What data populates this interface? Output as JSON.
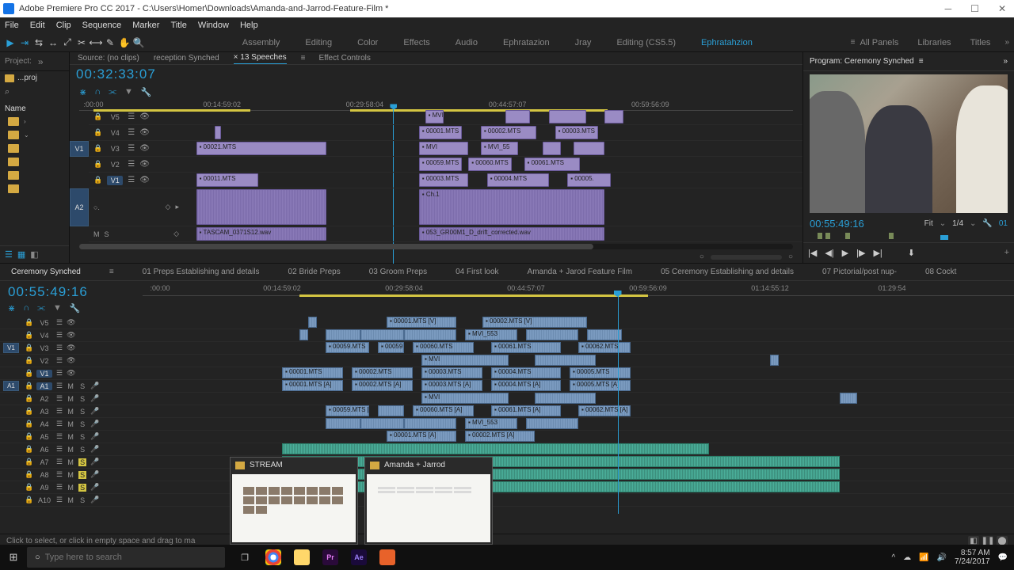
{
  "title": "Adobe Premiere Pro CC 2017 - C:\\Users\\Homer\\Downloads\\Amanda-and-Jarrod-Feature-Film *",
  "menu": [
    "File",
    "Edit",
    "Clip",
    "Sequence",
    "Marker",
    "Title",
    "Window",
    "Help"
  ],
  "workspaces": [
    "Assembly",
    "Editing",
    "Color",
    "Effects",
    "Audio",
    "Ephratazion",
    "Jray",
    "Editing (CS5.5)",
    "Ephratahzion"
  ],
  "ws_active": "Ephratahzion",
  "ws_right": [
    "All Panels",
    "Libraries",
    "Titles"
  ],
  "project": {
    "tab": "Project:",
    "bin": "...proj",
    "name_head": "Name"
  },
  "source": {
    "tabs": [
      "Source: (no clips)",
      "reception Synched",
      "× 13 Speeches",
      "Effect Controls"
    ],
    "active_idx": 2,
    "timecode": "00:32:33:07",
    "ruler_ticks": [
      {
        "t": ":00:00",
        "pct": 2
      },
      {
        "t": "00:14:59:02",
        "pct": 20
      },
      {
        "t": "00:29:58:04",
        "pct": 40
      },
      {
        "t": "00:44:57:07",
        "pct": 60
      },
      {
        "t": "00:59:56:09",
        "pct": 80
      }
    ],
    "playhead_pct": 44,
    "yellow": [
      {
        "l": 2,
        "w": 22
      },
      {
        "l": 38,
        "w": 36
      }
    ],
    "tracks": [
      {
        "lbl": "V5"
      },
      {
        "lbl": "V4"
      },
      {
        "lbl": "V3"
      },
      {
        "lbl": "V2"
      },
      {
        "lbl": "V1",
        "box": true
      }
    ],
    "target_v": "V1",
    "target_a": "A2",
    "clips_v5": [
      {
        "l": 39,
        "w": 3,
        "n": "MVI"
      },
      {
        "l": 52,
        "w": 4,
        "n": ""
      },
      {
        "l": 59,
        "w": 6,
        "n": ""
      },
      {
        "l": 68,
        "w": 3,
        "n": ""
      }
    ],
    "clips_v4": [
      {
        "l": 5,
        "w": 1,
        "n": ""
      },
      {
        "l": 38,
        "w": 7,
        "n": "00001.MTS"
      },
      {
        "l": 48,
        "w": 9,
        "n": "00002.MTS"
      },
      {
        "l": 60,
        "w": 7,
        "n": "00003.MTS"
      }
    ],
    "clips_v3": [
      {
        "l": 2,
        "w": 21,
        "n": "00021.MTS"
      },
      {
        "l": 38,
        "w": 8,
        "n": "MVI"
      },
      {
        "l": 48,
        "w": 6,
        "n": "MVI_55"
      },
      {
        "l": 58,
        "w": 3,
        "n": ""
      },
      {
        "l": 63,
        "w": 5,
        "n": ""
      }
    ],
    "clips_v2": [
      {
        "l": 38,
        "w": 7,
        "n": "00059.MTS"
      },
      {
        "l": 46,
        "w": 7,
        "n": "00060.MTS"
      },
      {
        "l": 55,
        "w": 9,
        "n": "00061.MTS"
      }
    ],
    "clips_v1": [
      {
        "l": 2,
        "w": 10,
        "n": "00011.MTS"
      },
      {
        "l": 38,
        "w": 8,
        "n": "00003.MTS"
      },
      {
        "l": 49,
        "w": 10,
        "n": "00004.MTS"
      },
      {
        "l": 62,
        "w": 7,
        "n": "00005."
      }
    ],
    "clips_a1": [
      {
        "l": 2,
        "w": 21,
        "n": "",
        "wave": true
      },
      {
        "l": 38,
        "w": 30,
        "n": "Ch.1",
        "wave": true
      }
    ],
    "clips_a2": [
      {
        "l": 2,
        "w": 21,
        "n": "TASCAM_0371S12.wav",
        "wave": true
      },
      {
        "l": 38,
        "w": 30,
        "n": "053_GR00M1_D_drift_corrected.wav",
        "wave": true
      }
    ]
  },
  "program": {
    "tab": "Program: Ceremony Synched",
    "timecode": "00:55:49:16",
    "fit": "Fit",
    "zoom": "1/4",
    "frame": "01"
  },
  "timeline": {
    "seq_tabs": [
      "Ceremony Synched",
      "01 Preps Establishing and details",
      "02 Bride Preps",
      "03 Groom Preps",
      "04 First look",
      "Amanda + Jarod Feature Film",
      "05 Ceremony Establishing and details",
      "07 Pictorial/post nup-",
      "08 Cockt"
    ],
    "active_idx": 0,
    "timecode": "00:55:49:16",
    "ruler_ticks": [
      {
        "t": ":00:00",
        "pct": 2
      },
      {
        "t": "00:14:59:02",
        "pct": 16
      },
      {
        "t": "00:29:58:04",
        "pct": 30
      },
      {
        "t": "00:44:57:07",
        "pct": 44
      },
      {
        "t": "00:59:56:09",
        "pct": 58
      },
      {
        "t": "01:14:55:12",
        "pct": 72
      },
      {
        "t": "01:29:54",
        "pct": 86
      }
    ],
    "playhead_pct": 54.5,
    "yellow": [
      {
        "l": 18,
        "w": 40
      }
    ],
    "vtracks": [
      {
        "lbl": "V5"
      },
      {
        "lbl": "V4"
      },
      {
        "lbl": "V3",
        "tgt": "V1"
      },
      {
        "lbl": "V2"
      },
      {
        "lbl": "V1",
        "box": true
      }
    ],
    "atracks": [
      {
        "lbl": "A1",
        "box": true,
        "tgt": "A1"
      },
      {
        "lbl": "A2"
      },
      {
        "lbl": "A3"
      },
      {
        "lbl": "A4"
      },
      {
        "lbl": "A5"
      },
      {
        "lbl": "A6"
      },
      {
        "lbl": "A7",
        "solo": true
      },
      {
        "lbl": "A8",
        "solo": true
      },
      {
        "lbl": "A9",
        "solo": true
      },
      {
        "lbl": "A10"
      }
    ],
    "vclips": {
      "V5": [
        {
          "l": 19,
          "w": 1
        },
        {
          "l": 28,
          "w": 8,
          "n": "00001.MTS [V]"
        },
        {
          "l": 39,
          "w": 12,
          "n": "00002.MTS [V]"
        }
      ],
      "V4": [
        {
          "l": 18,
          "w": 1
        },
        {
          "l": 21,
          "w": 4
        },
        {
          "l": 25,
          "w": 5
        },
        {
          "l": 30,
          "w": 6
        },
        {
          "l": 37,
          "w": 6,
          "n": "MVI_553"
        },
        {
          "l": 44,
          "w": 6
        },
        {
          "l": 51,
          "w": 4
        }
      ],
      "V3": [
        {
          "l": 21,
          "w": 5,
          "n": "00059.MTS"
        },
        {
          "l": 27,
          "w": 3,
          "n": "00059"
        },
        {
          "l": 31,
          "w": 7,
          "n": "00060.MTS"
        },
        {
          "l": 40,
          "w": 8,
          "n": "00061.MTS"
        },
        {
          "l": 50,
          "w": 6,
          "n": "00062.MTS"
        }
      ],
      "V2": [
        {
          "l": 32,
          "w": 10,
          "n": "MVI"
        },
        {
          "l": 45,
          "w": 7
        },
        {
          "l": 72,
          "w": 1
        }
      ],
      "V1": [
        {
          "l": 16,
          "w": 7,
          "n": "00001.MTS"
        },
        {
          "l": 24,
          "w": 7,
          "n": "00002.MTS"
        },
        {
          "l": 32,
          "w": 7,
          "n": "00003.MTS"
        },
        {
          "l": 40,
          "w": 8,
          "n": "00004.MTS"
        },
        {
          "l": 49,
          "w": 7,
          "n": "00005.MTS"
        }
      ]
    },
    "aclips": {
      "A1": [
        {
          "l": 16,
          "w": 7,
          "n": "00001.MTS [A]"
        },
        {
          "l": 24,
          "w": 7,
          "n": "00002.MTS [A]"
        },
        {
          "l": 32,
          "w": 7,
          "n": "00003.MTS [A]"
        },
        {
          "l": 40,
          "w": 8,
          "n": "00004.MTS [A]"
        },
        {
          "l": 49,
          "w": 7,
          "n": "00005.MTS [A]"
        }
      ],
      "A2": [
        {
          "l": 32,
          "w": 10,
          "n": "MVI"
        },
        {
          "l": 45,
          "w": 7
        },
        {
          "l": 80,
          "w": 2
        }
      ],
      "A3": [
        {
          "l": 21,
          "w": 5,
          "n": "00059.MTS [A]"
        },
        {
          "l": 27,
          "w": 3
        },
        {
          "l": 31,
          "w": 7,
          "n": "00060.MTS [A]"
        },
        {
          "l": 40,
          "w": 8,
          "n": "00061.MTS [A]"
        },
        {
          "l": 50,
          "w": 6,
          "n": "00062.MTS [A]"
        }
      ],
      "A4": [
        {
          "l": 21,
          "w": 4
        },
        {
          "l": 25,
          "w": 5
        },
        {
          "l": 30,
          "w": 6
        },
        {
          "l": 37,
          "w": 6,
          "n": "MVI_553"
        },
        {
          "l": 44,
          "w": 6
        }
      ],
      "A5": [
        {
          "l": 28,
          "w": 8,
          "n": "00001.MTS [A]"
        },
        {
          "l": 37,
          "w": 8,
          "n": "00002.MTS [A]"
        }
      ],
      "A6": [
        {
          "l": 16,
          "w": 49,
          "aud2": true
        }
      ],
      "A7": [
        {
          "l": 16,
          "w": 64,
          "aud2": true
        }
      ],
      "A8": [
        {
          "l": 16,
          "w": 64,
          "aud2": true
        }
      ],
      "A9": [
        {
          "l": 16,
          "w": 64,
          "aud2": true
        }
      ],
      "A10": []
    }
  },
  "status": "Click to select, or click in empty space and drag to ma",
  "popups": [
    {
      "title": "STREAM"
    },
    {
      "title": "Amanda + Jarrod"
    }
  ],
  "taskbar": {
    "search_placeholder": "Type here to search",
    "time": "8:57 AM",
    "date": "7/24/2017"
  }
}
